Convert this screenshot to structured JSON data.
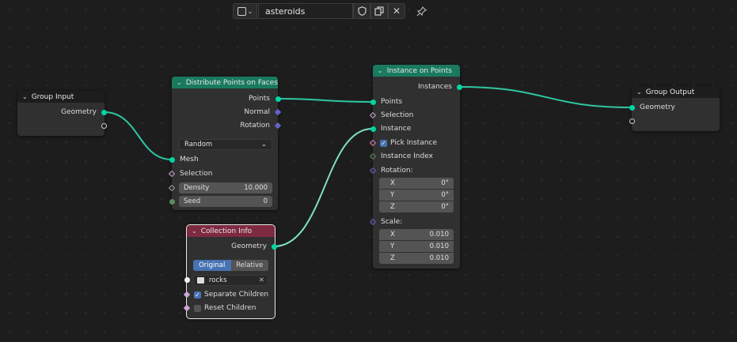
{
  "header": {
    "tree_name": "asteroids",
    "icons": [
      "node-tree-type-icon",
      "chevron-down-icon",
      "fake-user-shield-icon",
      "duplicate-icon",
      "close-icon",
      "pin-icon"
    ]
  },
  "colors": {
    "geometry_socket": "#00d6a3",
    "vector_socket": "#6363c7",
    "boolean_socket": "#cca6d6",
    "integer_socket": "#598c5c",
    "geometry_header": "#1a7a5e",
    "input_header": "#7e2a41",
    "checkbox_on": "#4772b3"
  },
  "nodes": {
    "group_input": {
      "title": "Group Input",
      "outputs": [
        "Geometry"
      ]
    },
    "distribute": {
      "title": "Distribute Points on Faces",
      "outputs": [
        "Points",
        "Normal",
        "Rotation"
      ],
      "mode": "Random",
      "mesh_label": "Mesh",
      "selection_label": "Selection",
      "density_label": "Density",
      "density_value": "10.000",
      "seed_label": "Seed",
      "seed_value": "0"
    },
    "collection_info": {
      "title": "Collection Info",
      "output": "Geometry",
      "transform_space": [
        "Original",
        "Relative"
      ],
      "collection": "rocks",
      "separate_children_label": "Separate Children",
      "separate_children": true,
      "reset_children_label": "Reset Children",
      "reset_children": false
    },
    "instance_on_points": {
      "title": "Instance on Points",
      "output": "Instances",
      "points_label": "Points",
      "selection_label": "Selection",
      "instance_label": "Instance",
      "pick_instance_label": "Pick Instance",
      "pick_instance": true,
      "instance_index_label": "Instance Index",
      "rotation_label": "Rotation:",
      "rotation": [
        {
          "axis": "X",
          "value": "0°"
        },
        {
          "axis": "Y",
          "value": "0°"
        },
        {
          "axis": "Z",
          "value": "0°"
        }
      ],
      "scale_label": "Scale:",
      "scale": [
        {
          "axis": "X",
          "value": "0.010"
        },
        {
          "axis": "Y",
          "value": "0.010"
        },
        {
          "axis": "Z",
          "value": "0.010"
        }
      ]
    },
    "group_output": {
      "title": "Group Output",
      "inputs": [
        "Geometry"
      ]
    }
  }
}
